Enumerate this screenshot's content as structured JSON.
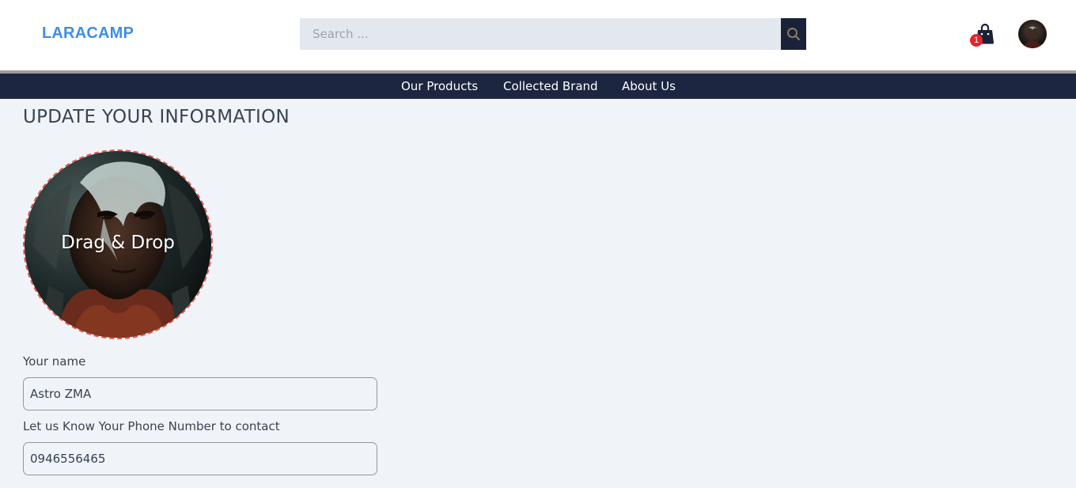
{
  "header": {
    "logo": "LARACAMP",
    "search": {
      "placeholder": "Search ...",
      "value": ""
    },
    "cart": {
      "count": "1"
    }
  },
  "nav": {
    "items": [
      {
        "label": "Our Products"
      },
      {
        "label": "Collected Brand"
      },
      {
        "label": "About Us"
      }
    ]
  },
  "page": {
    "title": "UPDATE YOUR INFORMATION",
    "avatar_drop_label": "Drag & Drop"
  },
  "form": {
    "name_label": "Your name",
    "name_value": "Astro ZMA",
    "phone_label": "Let us Know Your Phone Number to contact",
    "phone_value": "0946556465"
  },
  "colors": {
    "brand": "#3b8ee8",
    "nav_bg": "#1c2640",
    "badge": "#e3262c",
    "dropzone_border": "#e85a4f"
  },
  "icons": {
    "search": "search-icon",
    "cart": "shopping-bag-icon"
  }
}
